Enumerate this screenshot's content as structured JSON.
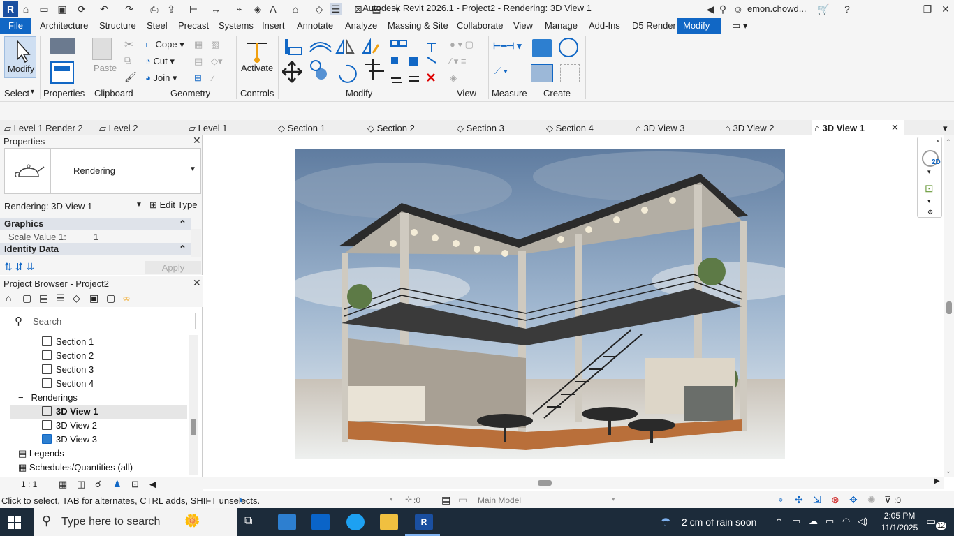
{
  "window": {
    "title": "Autodesk Revit 2026.1 - Project2 - Rendering: 3D View 1",
    "logo": "R",
    "user": "emon.chowd..."
  },
  "menu": {
    "items": [
      "File",
      "Architecture",
      "Structure",
      "Steel",
      "Precast",
      "Systems",
      "Insert",
      "Annotate",
      "Analyze",
      "Massing & Site",
      "Collaborate",
      "View",
      "Manage",
      "Add-Ins",
      "D5 Render",
      "Modify"
    ],
    "active": "Modify"
  },
  "ribbon": {
    "modify_label": "Modify",
    "select_label": "Select",
    "properties_label": "Properties",
    "clipboard_label": "Clipboard",
    "paste_label": "Paste",
    "cope_label": "Cope",
    "cut_label": "Cut",
    "join_label": "Join",
    "geometry_label": "Geometry",
    "activate_label": "Activate",
    "controls_label": "Controls",
    "modify_panel_label": "Modify",
    "view_label": "View",
    "measure_label": "Measure",
    "create_label": "Create"
  },
  "view_tabs": [
    {
      "label": "Level 1 Render 2",
      "icon": "plan-icon"
    },
    {
      "label": "Level 2",
      "icon": "plan-icon"
    },
    {
      "label": "Level 1",
      "icon": "plan-icon"
    },
    {
      "label": "Section 1",
      "icon": "section-icon"
    },
    {
      "label": "Section 2",
      "icon": "section-icon"
    },
    {
      "label": "Section 3",
      "icon": "section-icon"
    },
    {
      "label": "Section 4",
      "icon": "section-icon"
    },
    {
      "label": "3D View 3",
      "icon": "3d-icon"
    },
    {
      "label": "3D View 2",
      "icon": "3d-icon"
    },
    {
      "label": "3D View 1",
      "icon": "3d-icon",
      "active": true
    }
  ],
  "properties": {
    "title": "Properties",
    "type_name": "Rendering",
    "instance_selector": "Rendering: 3D View 1",
    "edit_type": "Edit Type",
    "graphics_header": "Graphics",
    "scale_label": "Scale Value",
    "scale_prefix": "1:",
    "scale_value": "1",
    "identity_header": "Identity Data",
    "apply": "Apply"
  },
  "browser": {
    "title": "Project Browser - Project2",
    "search_placeholder": "Search",
    "items": [
      "Section 1",
      "Section 2",
      "Section 3",
      "Section 4",
      "Renderings",
      "3D View 1",
      "3D View 2",
      "3D View 3",
      "Legends",
      "Schedules/Quantities (all)"
    ]
  },
  "view_control": {
    "scale": "1 : 1"
  },
  "status": {
    "message": "Click to select, TAB for alternates, CTRL adds, SHIFT unselects.",
    "worksets_count": ":0",
    "model": "Main Model",
    "filter_count": ":0"
  },
  "taskbar": {
    "search_placeholder": "Type here to search",
    "weather": "2 cm of rain soon",
    "time": "2:05 PM",
    "date": "11/1/2025",
    "notifications": "12"
  },
  "colors": {
    "accent": "#1167c5",
    "taskbar": "#1c2b3a"
  }
}
